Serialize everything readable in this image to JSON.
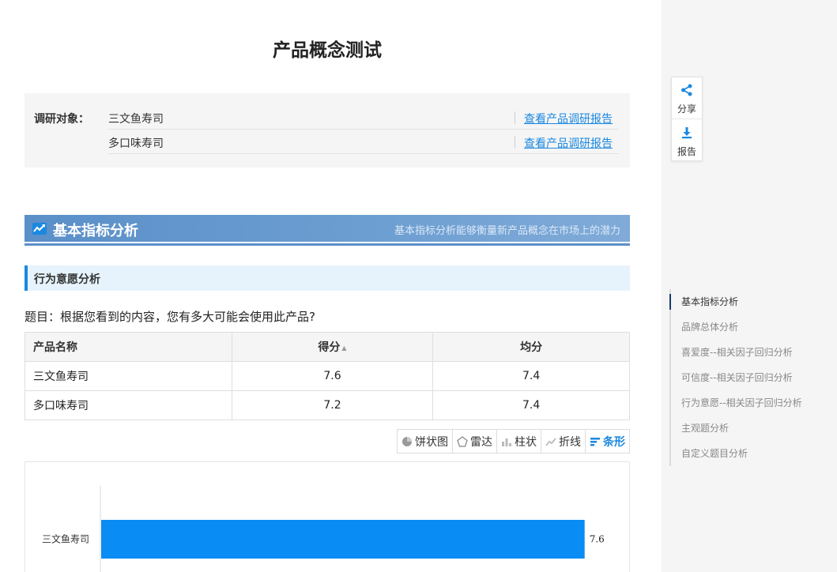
{
  "page": {
    "title": "产品概念测试"
  },
  "research_target": {
    "label": "调研对象：",
    "products": [
      {
        "name": "三文鱼寿司",
        "link": "查看产品调研报告"
      },
      {
        "name": "多口味寿司",
        "link": "查看产品调研报告"
      }
    ]
  },
  "section": {
    "title": "基本指标分析",
    "description": "基本指标分析能够衡量新产品概念在市场上的潜力",
    "icon": "trend-chart-icon"
  },
  "subsection": {
    "title": "行为意愿分析"
  },
  "question": "题目：根据您看到的内容，您有多大可能会使用此产品?",
  "table": {
    "headers": [
      "产品名称",
      "得分",
      "均分"
    ],
    "rows": [
      [
        "三文鱼寿司",
        "7.6",
        "7.4"
      ],
      [
        "多口味寿司",
        "7.2",
        "7.4"
      ]
    ]
  },
  "chart_toolbar": {
    "buttons": [
      {
        "label": "饼状图",
        "icon": "pie-icon",
        "active": false
      },
      {
        "label": "雷达",
        "icon": "radar-icon",
        "active": false
      },
      {
        "label": "柱状",
        "icon": "column-icon",
        "active": false
      },
      {
        "label": "折线",
        "icon": "line-icon",
        "active": false
      },
      {
        "label": "条形",
        "icon": "bar-icon",
        "active": true
      }
    ],
    "active_color": "#1a88e0"
  },
  "chart_data": {
    "type": "bar",
    "orientation": "horizontal",
    "categories": [
      "三文鱼寿司"
    ],
    "values": [
      7.6
    ],
    "data_labels": [
      "7.6"
    ],
    "bar_color": "#0a8cf5",
    "xlim": [
      0,
      8.2
    ]
  },
  "float_tools": {
    "share": {
      "label": "分享",
      "icon": "share-icon"
    },
    "report": {
      "label": "报告",
      "icon": "download-icon"
    }
  },
  "nav": {
    "items": [
      {
        "label": "基本指标分析",
        "active": true
      },
      {
        "label": "品牌总体分析",
        "active": false
      },
      {
        "label": "喜爱度--相关因子回归分析",
        "active": false
      },
      {
        "label": "可信度--相关因子回归分析",
        "active": false
      },
      {
        "label": "行为意愿--相关因子回归分析",
        "active": false
      },
      {
        "label": "主观题分析",
        "active": false
      },
      {
        "label": "自定义题目分析",
        "active": false
      }
    ]
  },
  "colors": {
    "accent": "#1a88e0",
    "banner": "#5a8fc8",
    "sidebar_bg": "#f5f5f5"
  }
}
